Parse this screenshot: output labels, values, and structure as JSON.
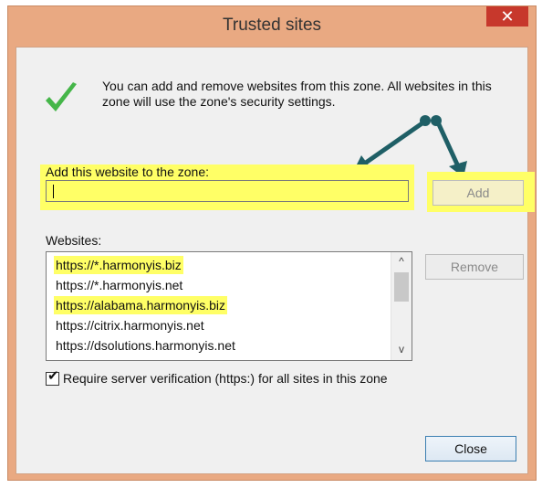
{
  "window": {
    "title": "Trusted sites",
    "close_glyph": "✕"
  },
  "info": {
    "icon": "checkmark-icon",
    "text": "You can add and remove websites from this zone. All websites in this zone will use the zone's security settings."
  },
  "add_section": {
    "label": "Add this website to the zone:",
    "input_value": "",
    "add_button": "Add"
  },
  "websites_section": {
    "label": "Websites:",
    "items": [
      {
        "url": "https://*.harmonyis.biz",
        "highlighted": true
      },
      {
        "url": "https://*.harmonyis.net",
        "highlighted": false
      },
      {
        "url": "https://alabama.harmonyis.biz",
        "highlighted": true
      },
      {
        "url": "https://citrix.harmonyis.net",
        "highlighted": false
      },
      {
        "url": "https://dsolutions.harmonyis.net",
        "highlighted": false
      }
    ],
    "remove_button": "Remove",
    "scroll_up_glyph": "^",
    "scroll_down_glyph": "v"
  },
  "verification": {
    "checked": true,
    "check_glyph": "✔",
    "label": "Require server verification (https:) for all sites in this zone"
  },
  "footer": {
    "close_button": "Close"
  },
  "colors": {
    "highlight": "#ffff66",
    "title_bar": "#e9a982",
    "close_button_bg": "#c7382c",
    "arrow": "#1f5f66",
    "checkmark": "#45b649"
  }
}
